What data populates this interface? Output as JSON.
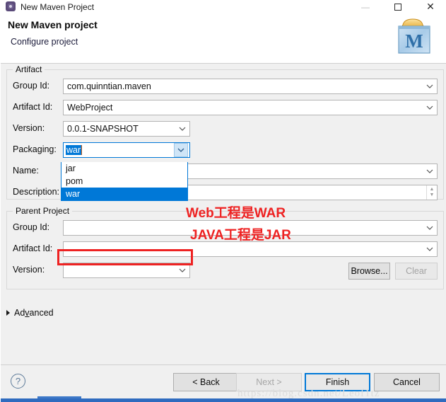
{
  "window": {
    "title": "New Maven Project",
    "icon": "maven-project-icon",
    "controls": {
      "minimize": "—",
      "maximize": "□",
      "close": "✕"
    }
  },
  "header": {
    "title": "New Maven project",
    "subtitle": "Configure project",
    "logo_letter": "M"
  },
  "artifact": {
    "legend": "Artifact",
    "fields": [
      {
        "label": "Group Id:",
        "value": "com.quinntian.maven",
        "type": "combo-wide"
      },
      {
        "label": "Artifact Id:",
        "value": "WebProject",
        "type": "combo-wide"
      },
      {
        "label": "Version:",
        "value": "0.0.1-SNAPSHOT",
        "type": "combo-narrow"
      },
      {
        "label": "Packaging:",
        "value": "war",
        "type": "combo-open"
      },
      {
        "label": "Name:",
        "value": "",
        "type": "combo-wide"
      },
      {
        "label": "Description:",
        "value": "",
        "type": "text-spin"
      }
    ]
  },
  "packaging_dropdown": {
    "options": [
      "jar",
      "pom",
      "war"
    ],
    "selected": "war"
  },
  "parent": {
    "legend": "Parent Project",
    "fields": [
      {
        "label": "Group Id:",
        "value": ""
      },
      {
        "label": "Artifact Id:",
        "value": ""
      },
      {
        "label": "Version:",
        "value": ""
      }
    ],
    "browse_label": "Browse...",
    "clear_label": "Clear"
  },
  "annotations": {
    "line1": "Web工程是WAR",
    "line2": "JAVA工程是JAR",
    "color": "#ee2222"
  },
  "advanced": {
    "label_pre": "Ad",
    "label_underlined": "v",
    "label_post": "anced"
  },
  "footer": {
    "help": "?",
    "back": "< Back",
    "next": "Next >",
    "finish": "Finish",
    "cancel": "Cancel"
  },
  "watermark": "https://blog.csdn.net/Leof1tz",
  "colors": {
    "accent": "#0078d7",
    "annotation_red": "#ee2222",
    "dialog_bg": "#f0f0f0",
    "taskbar_blue": "#2f6bbf"
  }
}
